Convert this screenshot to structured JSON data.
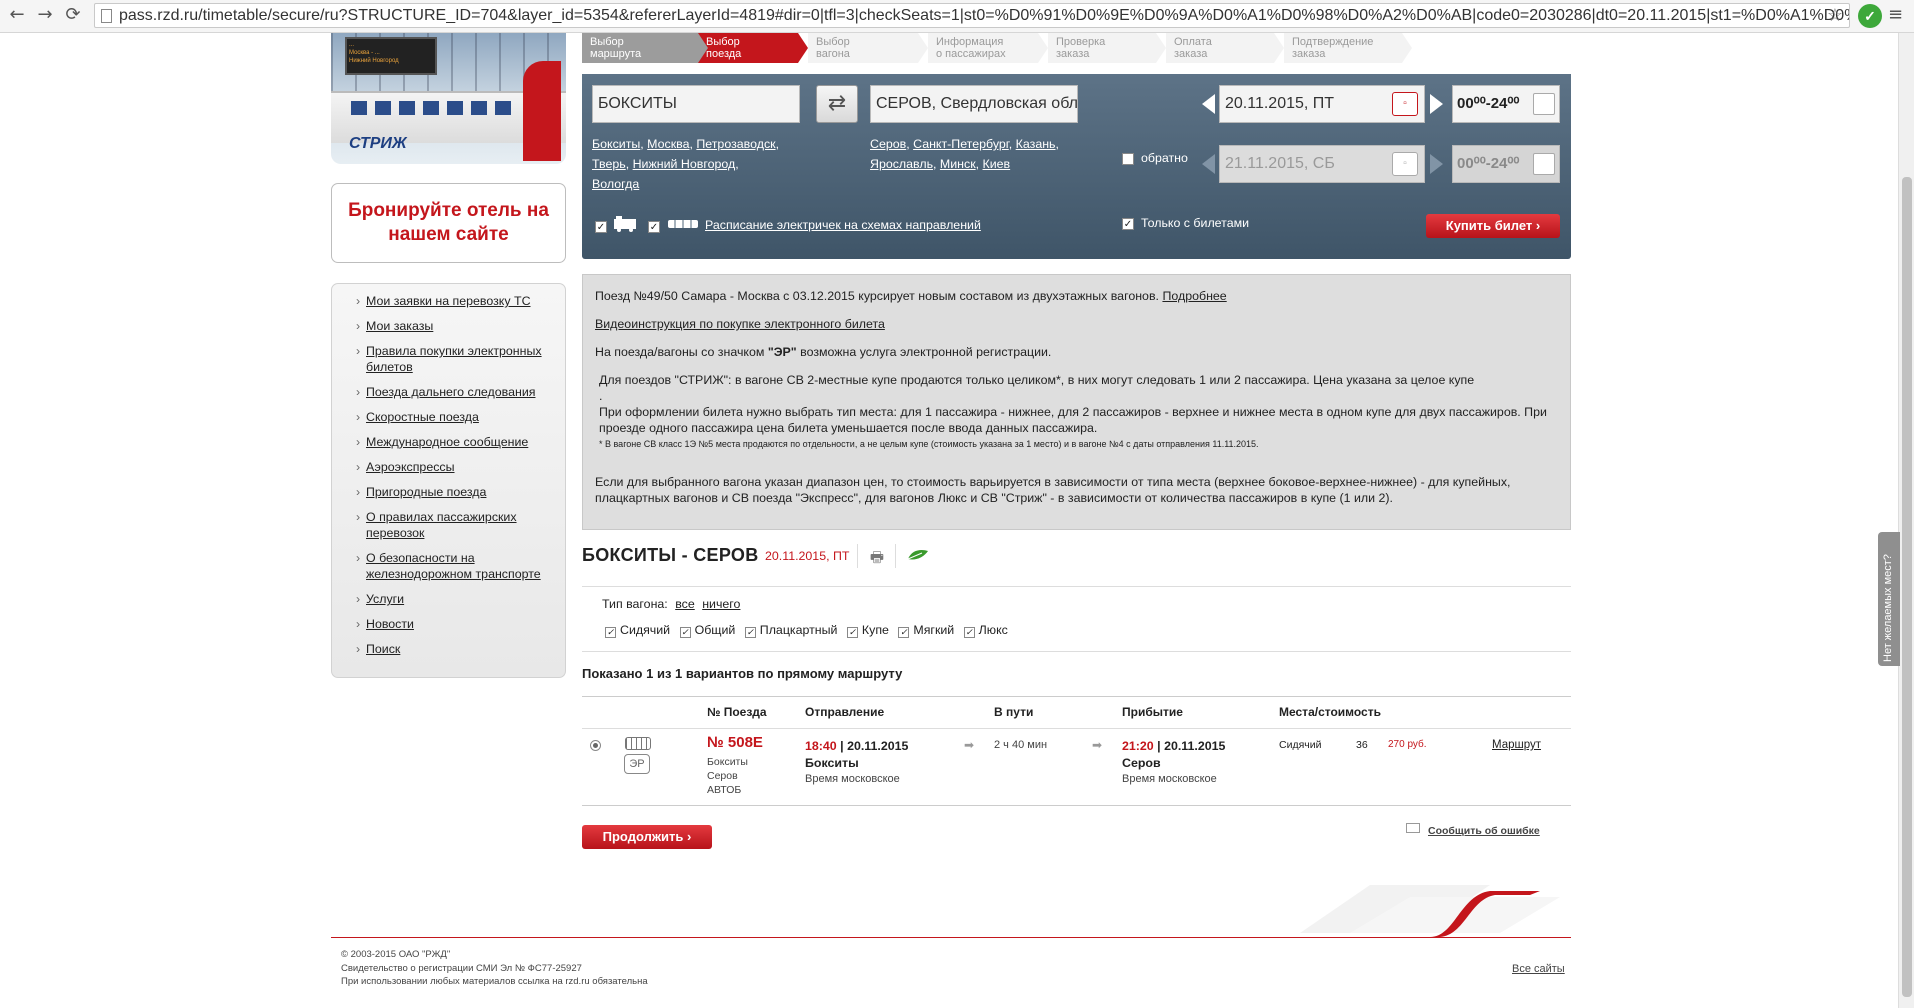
{
  "browser": {
    "url": "pass.rzd.ru/timetable/secure/ru?STRUCTURE_ID=704&layer_id=5354&refererLayerId=4819#dir=0|tfl=3|checkSeats=1|st0=%D0%91%D0%9E%D0%9A%D0%A1%D0%98%D0%A2%D0%AB|code0=2030286|dt0=20.11.2015|st1=%D0%A1%D0%95%",
    "back": "←",
    "forward": "→",
    "reload": "⟳",
    "star": "☆",
    "menu": "≡"
  },
  "feedback_tab": "Нет желаемых мест?",
  "logo": {
    "name": "СТРИЖ",
    "board_lines": [
      "...",
      "Москва - ...",
      "Нижний Новгород"
    ]
  },
  "hotel_banner": "Бронируйте отель на нашем сайте",
  "left_menu": [
    "Мои заявки на перевозку ТС",
    "Мои заказы",
    "Правила покупки электронных билетов",
    "Поезда дальнего следования",
    "Скоростные поезда",
    "Международное сообщение",
    "Аэроэкспрессы",
    "Пригородные поезда",
    "О правилах пассажирских перевозок",
    "О безопасности на железнодорожном транспорте",
    "Услуги",
    "Новости",
    "Поиск"
  ],
  "steps": [
    {
      "line1": "Выбор",
      "line2": "маршрута"
    },
    {
      "line1": "Выбор",
      "line2": "поезда"
    },
    {
      "line1": "Выбор",
      "line2": "вагона"
    },
    {
      "line1": "Информация",
      "line2": "о пассажирах"
    },
    {
      "line1": "Проверка",
      "line2": "заказа"
    },
    {
      "line1": "Оплата",
      "line2": "заказа"
    },
    {
      "line1": "Подтверждение",
      "line2": "заказа"
    }
  ],
  "search": {
    "from": "БОКСИТЫ",
    "to": "СЕРОВ, Свердловская обл",
    "swap_icon": "⇄",
    "from_suggest": [
      "Бокситы",
      "Москва",
      "Петрозаводск",
      "Тверь",
      "Нижний Новгород",
      "Вологда"
    ],
    "to_suggest": [
      "Серов",
      "Санкт-Петербург",
      "Казань",
      "Ярославль",
      "Минск",
      "Киев"
    ],
    "date_there": "20.11.2015, ПТ",
    "date_back": "21.11.2015, СБ",
    "time_there": "00⁰⁰-24⁰⁰",
    "time_back": "00⁰⁰-24⁰⁰",
    "return_label": "обратно",
    "only_with_tickets": "Только с билетами",
    "suburban_link": "Расписание электричек на схемах направлений",
    "buy_button": "Купить билет ›",
    "train_icon": "train-icon",
    "suburban_icon": "suburban-train-icon"
  },
  "info": {
    "p1": "Поезд №49/50 Самара - Москва с 03.12.2015 курсирует новым составом из двухэтажных вагонов.",
    "p1_link": "Подробнее",
    "p2_link": "Видеоинструкция по покупке электронного билета",
    "p3_a": "На поезда/вагоны со значком",
    "p3_b": "\"ЭР\"",
    "p3_c": "возможна услуга электронной регистрации.",
    "p4a": "Для поездов \"СТРИЖ\": в вагоне СВ 2-местные купе продаются только целиком*, в них могут следовать 1 или 2 пассажира. Цена указана за целое купе",
    "p4b": ".",
    "p4c": "При оформлении билета нужно выбрать тип места: для 1 пассажира - нижнее, для 2 пассажиров - верхнее и нижнее места в одном купе для двух пассажиров. При проезде одного пассажира цена билета уменьшается после ввода данных пассажира.",
    "p4d": "* В вагоне СВ класс 1Э №5 места продаются по отдельности, а не целым купе (стоимость указана за 1 место) и в вагоне №4 с даты отправления 11.11.2015.",
    "p5": "Если для выбранного вагона указан диапазон цен, то стоимость варьируется в зависимости от типа места (верхнее боковое-верхнее-нижнее) - для купейных, плацкартных вагонов и СВ поезда \"Экспресс\", для вагонов Люкс и СВ \"Стриж\" - в зависимости от количества пассажиров в купе (1 или 2)."
  },
  "route": {
    "title": "БОКСИТЫ - СЕРОВ",
    "date": "20.11.2015, ПТ",
    "print_icon": "🖶"
  },
  "wagon_filter": {
    "label": "Тип вагона:",
    "all": "все",
    "none": "ничего",
    "types": [
      "Сидячий",
      "Общий",
      "Плацкартный",
      "Купе",
      "Мягкий",
      "Люкс"
    ]
  },
  "shown_text": "Показано 1 из 1 вариантов по прямому маршруту",
  "table": {
    "headers": [
      "№ Поезда",
      "Отправление",
      "В пути",
      "Прибытие",
      "Места/стоимость"
    ],
    "row": {
      "train_no": "№ 508Е",
      "train_route1": "Бокситы",
      "train_route2": "Серов",
      "train_type": "АВТОБ",
      "er_badge": "ЭР",
      "dep_time": "18:40",
      "dep_date": "| 20.11.2015",
      "dep_station": "Бокситы",
      "dep_tz": "Время московское",
      "duration": "2 ч 40 мин",
      "arr_time": "21:20",
      "arr_date": "| 20.11.2015",
      "arr_station": "Серов",
      "arr_tz": "Время московское",
      "seat_type": "Сидячий",
      "seat_count": "36",
      "price": "270 руб.",
      "route_link": "Маршрут",
      "arrow": "➡"
    }
  },
  "continue_button": "Продолжить ›",
  "report_error": "Сообщить об ошибке",
  "footer": {
    "line1": "© 2003-2015 ОАО \"РЖД\"",
    "line2": "Свидетельство о регистрации СМИ Эл № ФС77-25927",
    "line3": "При использовании любых материалов ссылка на rzd.ru обязательна",
    "all_sites": "Все сайты"
  },
  "colors": {
    "accent": "#c4161c",
    "panel": "#4d6478"
  }
}
